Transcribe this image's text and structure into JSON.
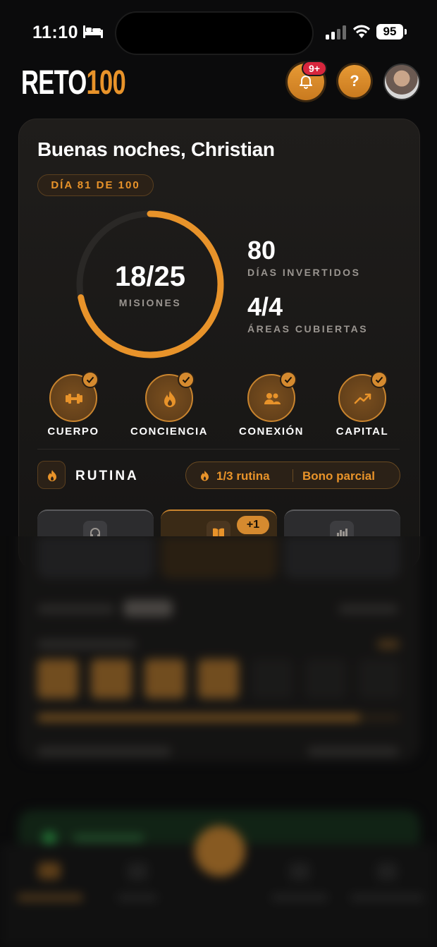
{
  "status_bar": {
    "time": "11:10",
    "battery": "95"
  },
  "header": {
    "logo_word": "RETO",
    "logo_number": "100",
    "notifications_badge": "9+",
    "help_label": "?"
  },
  "dashboard": {
    "greeting": "Buenas noches, Christian",
    "day_pill": "DÍA 81 DE 100",
    "missions": {
      "value": "18/25",
      "label": "MISIONES",
      "completed": 18,
      "total": 25
    },
    "stats": [
      {
        "value": "80",
        "label": "DÍAS INVERTIDOS"
      },
      {
        "value": "4/4",
        "label": "ÁREAS CUBIERTAS"
      }
    ],
    "areas": [
      {
        "label": "CUERPO",
        "icon": "dumbbell-icon",
        "checked": true
      },
      {
        "label": "CONCIENCIA",
        "icon": "flame-icon",
        "checked": true
      },
      {
        "label": "CONEXIÓN",
        "icon": "people-icon",
        "checked": true
      },
      {
        "label": "CAPITAL",
        "icon": "trending-up-icon",
        "checked": true
      }
    ]
  },
  "routine": {
    "title": "RUTINA",
    "count": "1/3 rutina",
    "bonus": "Bono parcial",
    "tiles": [
      {
        "icon": "headphones-icon",
        "active": false
      },
      {
        "icon": "book-icon",
        "active": true,
        "badge": "+1"
      },
      {
        "icon": "bar-chart-icon",
        "active": false
      }
    ]
  },
  "colors": {
    "accent": "#e8932a",
    "background": "#0b0b0c",
    "card": "#1f1d1b",
    "badge_red": "#d7263d"
  }
}
